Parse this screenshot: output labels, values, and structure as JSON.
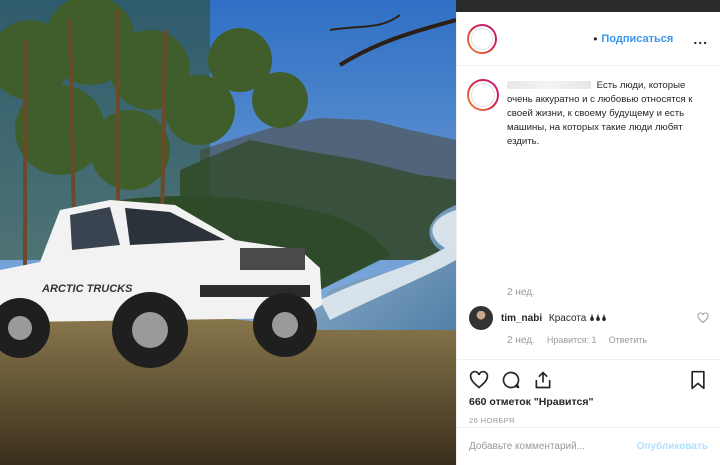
{
  "header": {
    "separator": "•",
    "follow_label": "Подписаться",
    "more_label": "..."
  },
  "caption": {
    "text": "Есть люди, которые очень аккуратно и с любовью относятся к своей жизни, к своему будущему и есть машины, на которых такие люди любят ездить.",
    "time": "2 нед."
  },
  "photo": {
    "truck_text": "ARCTIC TRUCKS"
  },
  "comment": {
    "user": "tim_nabi",
    "text": "Красота 🌢🌢🌢",
    "time": "2 нед.",
    "likes": "Нравится: 1",
    "reply": "Ответить"
  },
  "actions": {
    "likes_count": "660 отметок \"Нравится\"",
    "date": "26 НОЯБРЯ"
  },
  "add_comment": {
    "placeholder": "Добавьте комментарий...",
    "publish_label": "Опубликовать"
  },
  "colors": {
    "accent": "#3897f0",
    "publish_disabled": "#b2dffc"
  }
}
